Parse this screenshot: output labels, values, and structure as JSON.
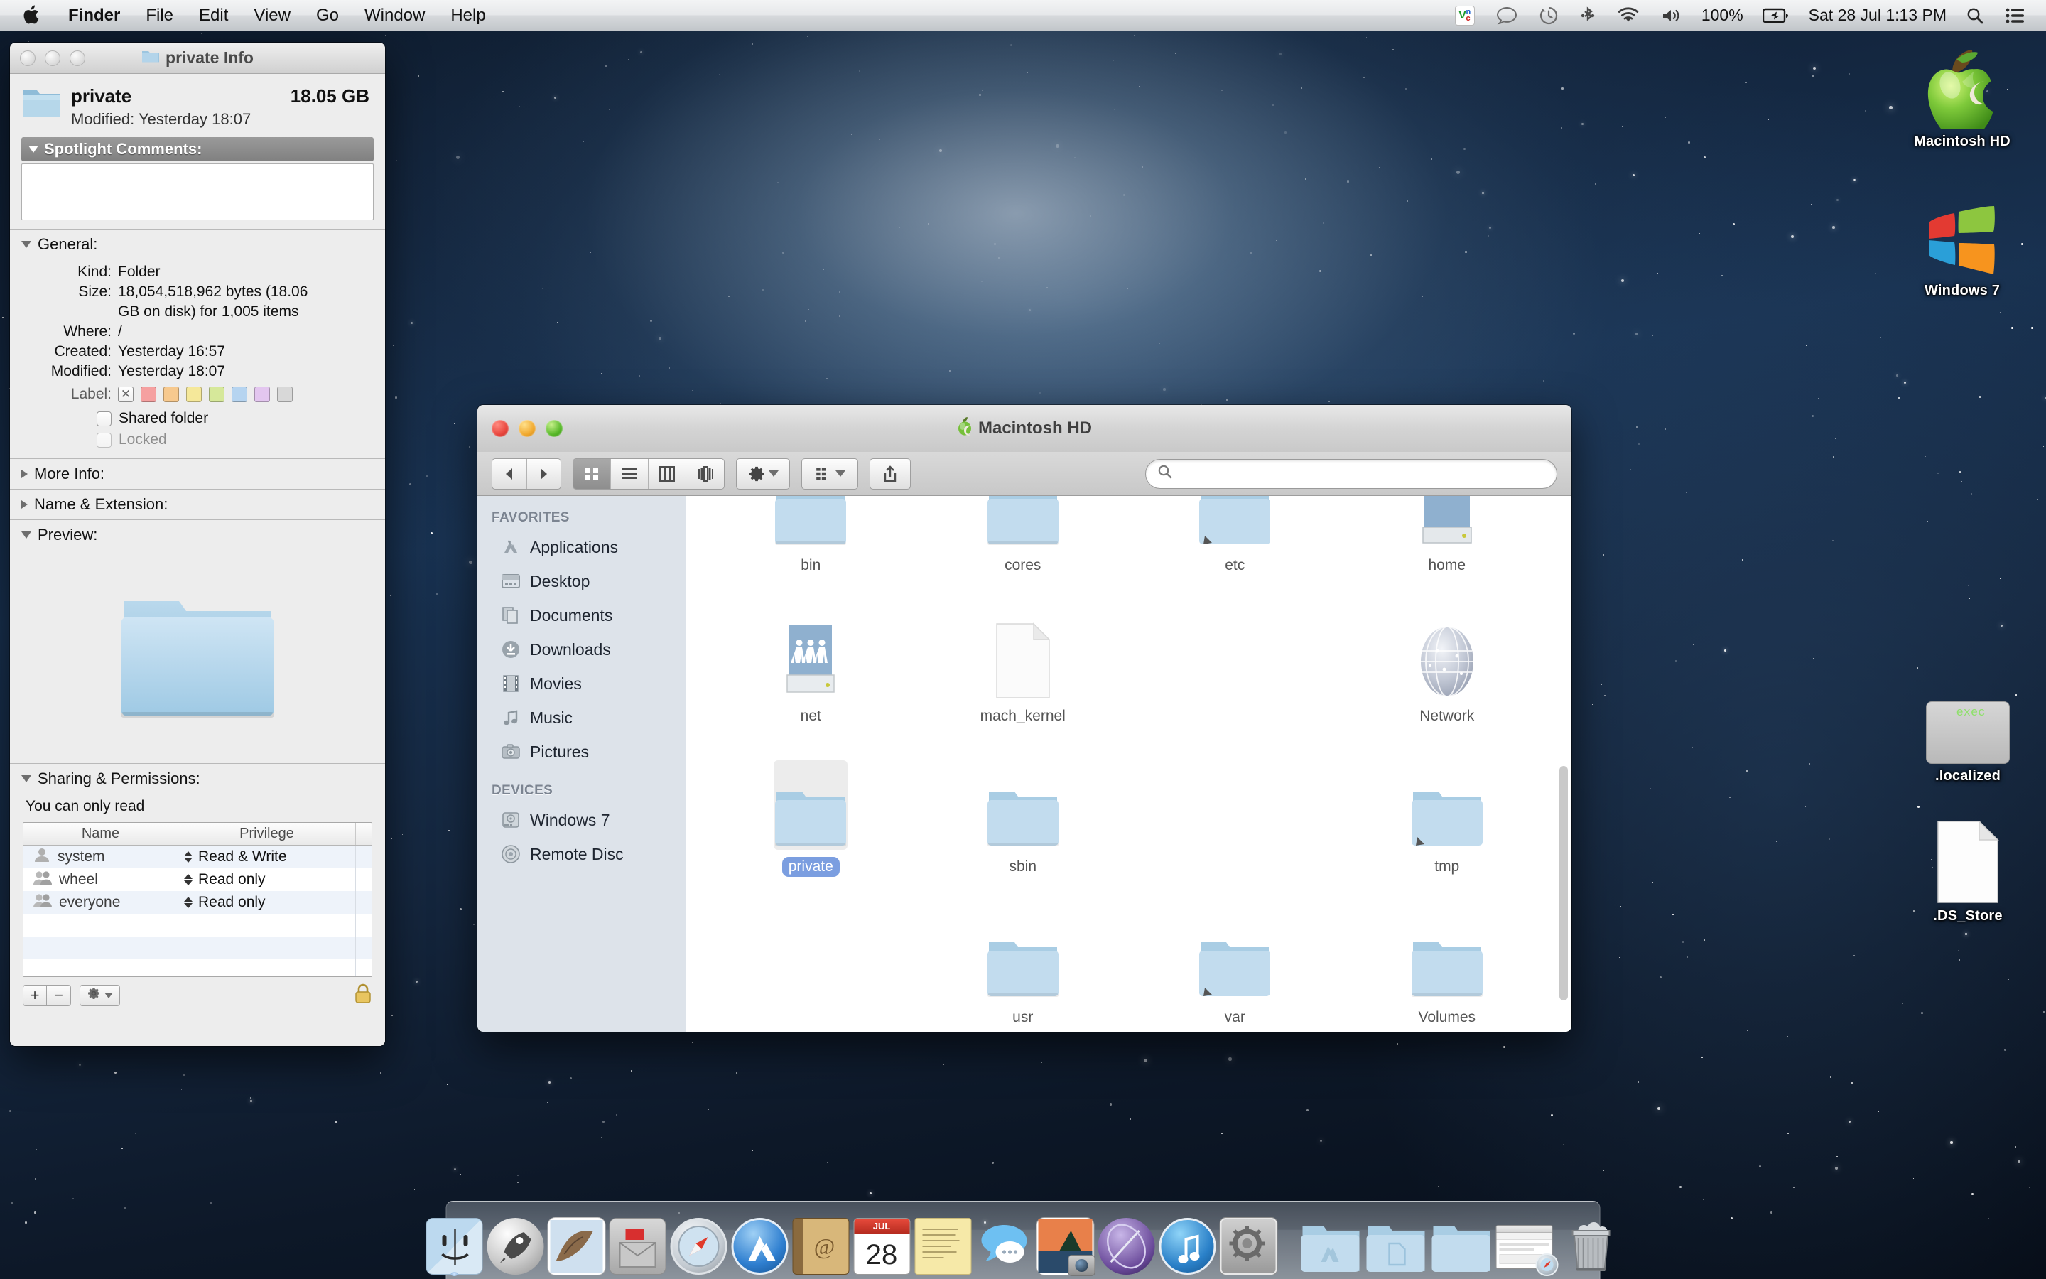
{
  "menubar": {
    "apple_icon": "apple-logo-icon",
    "items": [
      {
        "label": "Finder",
        "bold": true
      },
      {
        "label": "File",
        "bold": false
      },
      {
        "label": "Edit",
        "bold": false
      },
      {
        "label": "View",
        "bold": false
      },
      {
        "label": "Go",
        "bold": false
      },
      {
        "label": "Window",
        "bold": false
      },
      {
        "label": "Help",
        "bold": false
      }
    ],
    "status_icons": [
      "vnc-icon",
      "messages-bubble-icon",
      "time-machine-icon",
      "bluetooth-icon",
      "wifi-icon",
      "volume-icon"
    ],
    "battery_percent": "100%",
    "battery_icon": "battery-charging-icon",
    "datetime": "Sat 28 Jul  1:13 PM",
    "spotlight_icon": "search-icon",
    "notification_center_icon": "notification-center-icon"
  },
  "desktop": {
    "icons": [
      {
        "label": "Macintosh HD",
        "icon": "green-apple-drive-icon"
      },
      {
        "label": "Windows 7",
        "icon": "windows-logo-drive-icon"
      },
      {
        "label": ".localized",
        "icon": "exec-script-icon",
        "icon_text": "exec"
      },
      {
        "label": ".DS_Store",
        "icon": "blank-document-icon"
      }
    ]
  },
  "info_window": {
    "title": "private Info",
    "title_icon": "folder-icon",
    "traffic_lights": [
      "close",
      "minimize",
      "zoom"
    ],
    "header": {
      "icon": "folder-icon",
      "name": "private",
      "size": "18.05 GB",
      "modified": "Modified: Yesterday 18:07"
    },
    "spotlight_comments": {
      "title": "Spotlight Comments:",
      "value": ""
    },
    "general": {
      "title": "General:",
      "rows": [
        {
          "key": "Kind:",
          "value": "Folder"
        },
        {
          "key": "Size:",
          "value": "18,054,518,962 bytes (18.06 GB on disk) for 1,005 items"
        },
        {
          "key": "Where:",
          "value": "/"
        },
        {
          "key": "Created:",
          "value": "Yesterday 16:57"
        },
        {
          "key": "Modified:",
          "value": "Yesterday 18:07"
        }
      ],
      "label_key": "Label:",
      "label_swatches": [
        "none",
        "#f5a0a0",
        "#f7c98e",
        "#f5e89a",
        "#d6e89a",
        "#b6d4f0",
        "#e3c6ef",
        "#d8d8d8"
      ],
      "checkboxes": [
        {
          "label": "Shared folder",
          "checked": false,
          "disabled": false
        },
        {
          "label": "Locked",
          "checked": false,
          "disabled": true
        }
      ]
    },
    "more_info": {
      "title": "More Info:",
      "expanded": false
    },
    "name_extension": {
      "title": "Name & Extension:",
      "expanded": false
    },
    "preview": {
      "title": "Preview:",
      "expanded": true,
      "icon": "large-folder-icon"
    },
    "sharing": {
      "title": "Sharing & Permissions:",
      "note": "You can only read",
      "columns": [
        "Name",
        "Privilege"
      ],
      "rows": [
        {
          "icon": "single-user-icon",
          "name": "system",
          "privilege": "Read & Write"
        },
        {
          "icon": "group-users-icon",
          "name": "wheel",
          "privilege": "Read only"
        },
        {
          "icon": "group-users-icon",
          "name": "everyone",
          "privilege": "Read only"
        }
      ],
      "add_button": "+",
      "remove_button": "−",
      "action_button": "gear-icon",
      "lock_icon": "closed-lock-icon"
    }
  },
  "finder_window": {
    "title": "Macintosh HD",
    "title_icon": "green-apple-volume-icon",
    "toolbar": {
      "back_icon": "chevron-left-icon",
      "forward_icon": "chevron-right-icon",
      "view_modes": [
        "icon-view",
        "list-view",
        "column-view",
        "coverflow-view"
      ],
      "active_view": "icon-view",
      "action_icon": "gear-icon",
      "arrange_icon": "arrange-icon",
      "share_icon": "share-icon",
      "search_placeholder": "",
      "search_value": "",
      "search_icon": "search-icon"
    },
    "sidebar": {
      "sections": [
        {
          "header": "FAVORITES",
          "items": [
            {
              "label": "Applications",
              "icon": "applications-icon"
            },
            {
              "label": "Desktop",
              "icon": "desktop-icon"
            },
            {
              "label": "Documents",
              "icon": "documents-icon"
            },
            {
              "label": "Downloads",
              "icon": "downloads-icon"
            },
            {
              "label": "Movies",
              "icon": "movies-icon"
            },
            {
              "label": "Music",
              "icon": "music-icon"
            },
            {
              "label": "Pictures",
              "icon": "pictures-icon"
            }
          ]
        },
        {
          "header": "DEVICES",
          "items": [
            {
              "label": "Windows 7",
              "icon": "hard-drive-icon"
            },
            {
              "label": "Remote Disc",
              "icon": "optical-disc-icon"
            }
          ]
        }
      ]
    },
    "files": [
      {
        "name": "bin",
        "icon": "folder-icon",
        "selected": false,
        "alias": false
      },
      {
        "name": "cores",
        "icon": "folder-icon",
        "selected": false,
        "alias": false
      },
      {
        "name": "etc",
        "icon": "folder-icon",
        "selected": false,
        "alias": true
      },
      {
        "name": "home",
        "icon": "network-drive-icon",
        "selected": false,
        "alias": false
      },
      {
        "name": "net",
        "icon": "network-drive-icon",
        "selected": false,
        "alias": false
      },
      {
        "name": "mach_kernel",
        "icon": "blank-document-icon",
        "selected": false,
        "alias": false
      },
      {
        "name": "",
        "icon": "none",
        "selected": false,
        "alias": false
      },
      {
        "name": "Network",
        "icon": "network-globe-icon",
        "selected": false,
        "alias": false
      },
      {
        "name": "private",
        "icon": "folder-icon",
        "selected": true,
        "alias": false
      },
      {
        "name": "sbin",
        "icon": "folder-icon",
        "selected": false,
        "alias": false
      },
      {
        "name": "",
        "icon": "none",
        "selected": false,
        "alias": false
      },
      {
        "name": "tmp",
        "icon": "folder-icon",
        "selected": false,
        "alias": true
      },
      {
        "name": "usr",
        "icon": "folder-icon",
        "selected": false,
        "alias": false
      },
      {
        "name": "var",
        "icon": "folder-icon",
        "selected": false,
        "alias": true
      },
      {
        "name": "Volumes",
        "icon": "folder-icon",
        "selected": false,
        "alias": false
      },
      {
        "name": "",
        "icon": "none",
        "selected": false,
        "alias": false
      }
    ]
  },
  "dock": {
    "items": [
      {
        "name": "Finder",
        "icon": "finder-icon"
      },
      {
        "name": "Launchpad",
        "icon": "launchpad-icon"
      },
      {
        "name": "Mail",
        "icon": "mail-icon"
      },
      {
        "name": "Mail Downloads",
        "icon": "mail-stamp-icon"
      },
      {
        "name": "Safari",
        "icon": "safari-compass-icon"
      },
      {
        "name": "App Store",
        "icon": "app-store-icon"
      },
      {
        "name": "Contacts",
        "icon": "contacts-book-icon"
      },
      {
        "name": "Calendar",
        "icon": "calendar-icon",
        "badge": "28",
        "badge_month": "JUL"
      },
      {
        "name": "Notes",
        "icon": "notes-icon"
      },
      {
        "name": "Messages",
        "icon": "messages-icon"
      },
      {
        "name": "Photo Booth",
        "icon": "photo-booth-icon"
      },
      {
        "name": "iPhoto",
        "icon": "iphoto-icon"
      },
      {
        "name": "iTunes",
        "icon": "itunes-icon"
      },
      {
        "name": "System Preferences",
        "icon": "system-preferences-icon"
      }
    ],
    "stacks": [
      {
        "name": "Applications",
        "icon": "applications-folder-icon"
      },
      {
        "name": "Documents",
        "icon": "documents-folder-icon"
      },
      {
        "name": "Downloads",
        "icon": "downloads-folder-icon"
      },
      {
        "name": "Recent Window",
        "icon": "window-preview-icon"
      }
    ],
    "trash": {
      "name": "Trash",
      "icon": "trash-full-icon"
    }
  }
}
